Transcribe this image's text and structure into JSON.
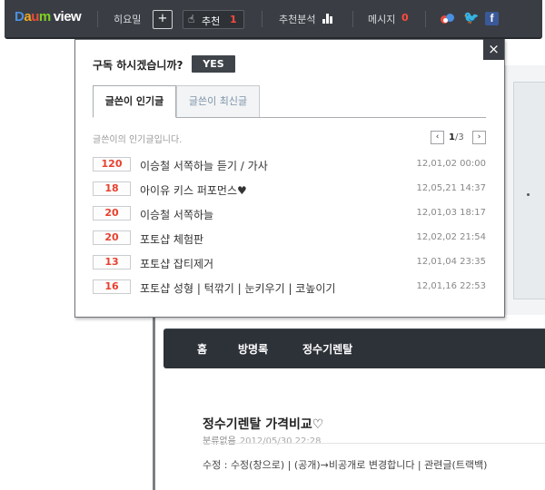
{
  "topbar": {
    "logo_daum": [
      "D",
      "a",
      "u",
      "m"
    ],
    "logo_view": "view",
    "greeting": "히요밀",
    "plus_label": "+",
    "recommend_label": "추천",
    "recommend_count": "1",
    "analysis_label": "추천분석",
    "message_label": "메시지",
    "message_count": "0",
    "facebook_label": "f"
  },
  "popup": {
    "close_label": "×",
    "subscribe_question": "구독 하시겠습니까?",
    "yes_label": "YES",
    "tabs": [
      {
        "label": "글쓴이 인기글",
        "active": true
      },
      {
        "label": "글쓴이 최신글",
        "active": false
      }
    ],
    "list_description": "글쓴이의 인기글입니다.",
    "pager": {
      "current": "1",
      "total": "/3",
      "prev": "‹",
      "next": "›"
    },
    "posts": [
      {
        "count": "120",
        "title": "이승철 서쪽하늘 듣기 / 가사",
        "time": "12,01,02 00:00"
      },
      {
        "count": "18",
        "title": "아이유 키스 퍼포먼스♥",
        "time": "12,05,21 14:37"
      },
      {
        "count": "20",
        "title": "이승철 서쪽하늘",
        "time": "12,01,03 18:17"
      },
      {
        "count": "20",
        "title": "포토샵 체험판",
        "time": "12,02,02 21:54"
      },
      {
        "count": "13",
        "title": "포토샵 잡티제거",
        "time": "12,01,04 23:35"
      },
      {
        "count": "16",
        "title": "포토샵 성형 | 턱깎기 | 눈키우기 | 코높이기",
        "time": "12,01,16 22:53"
      }
    ]
  },
  "blog": {
    "nav": [
      "홈",
      "방명록",
      "정수기렌탈"
    ],
    "post_title": "정수기렌탈 가격비교♡",
    "post_category": "분류없음",
    "post_date": "2012/05/30 22:28",
    "post_body": "수정 : 수정(창으로) | (공개)→비공개로 변경합니다 | 관련글(트랙백)"
  },
  "colors": {
    "topbar_bg": "#3a3e44",
    "accent_red": "#e8412f",
    "facebook": "#3b5998",
    "twitter": "#4fb2ea"
  }
}
